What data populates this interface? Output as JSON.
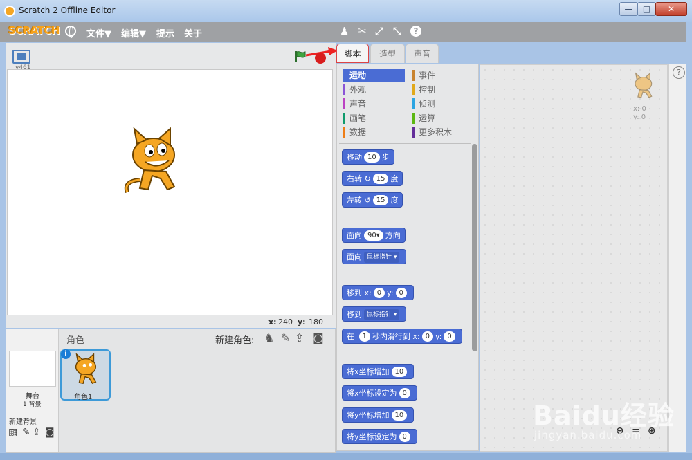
{
  "window": {
    "title": "Scratch 2 Offline Editor",
    "min": "—",
    "max": "□",
    "close": "✕"
  },
  "menubar": {
    "logo": "SCRATCH",
    "items": [
      "文件▼",
      "编辑▼",
      "提示",
      "关于"
    ]
  },
  "stage": {
    "version": "v461",
    "x_label": "x:",
    "x_value": "240",
    "y_label": "y:",
    "y_value": "180"
  },
  "tabs": [
    "脚本",
    "造型",
    "声音"
  ],
  "categories": [
    {
      "label": "运动",
      "color": "#4a6cd4"
    },
    {
      "label": "事件",
      "color": "#c88330"
    },
    {
      "label": "外观",
      "color": "#8a55d7"
    },
    {
      "label": "控制",
      "color": "#e1a91a"
    },
    {
      "label": "声音",
      "color": "#bb42c3"
    },
    {
      "label": "侦测",
      "color": "#2ca5e2"
    },
    {
      "label": "画笔",
      "color": "#0e9a6c"
    },
    {
      "label": "运算",
      "color": "#5cb712"
    },
    {
      "label": "数据",
      "color": "#ee7d16"
    },
    {
      "label": "更多积木",
      "color": "#632d99"
    }
  ],
  "blocks": {
    "move": {
      "a": "移动",
      "v": "10",
      "b": "步"
    },
    "turn_right": {
      "a": "右转",
      "icon": "↻",
      "v": "15",
      "b": "度"
    },
    "turn_left": {
      "a": "左转",
      "icon": "↺",
      "v": "15",
      "b": "度"
    },
    "point_dir": {
      "a": "面向",
      "v": "90▾",
      "b": "方向"
    },
    "point_towards": {
      "a": "面向",
      "dd": "鼠标指针 ▾"
    },
    "goto_xy": {
      "a": "移到",
      "x": "x:",
      "xv": "0",
      "y": "y:",
      "yv": "0"
    },
    "goto": {
      "a": "移到",
      "dd": "鼠标指针 ▾"
    },
    "glide": {
      "a": "在",
      "v": "1",
      "b": "秒内滑行到",
      "x": "x:",
      "xv": "0",
      "y": "y:",
      "yv": "0"
    },
    "change_x": {
      "a": "将x坐标增加",
      "v": "10"
    },
    "set_x": {
      "a": "将x坐标设定为",
      "v": "0"
    },
    "change_y": {
      "a": "将y坐标增加",
      "v": "10"
    },
    "set_y": {
      "a": "将y坐标设定为",
      "v": "0"
    }
  },
  "sprites": {
    "title": "角色",
    "new_sprite": "新建角色:",
    "stage_label": "舞台",
    "backdrop_count": "1 背景",
    "new_backdrop": "新建背景",
    "sprite1_name": "角色1",
    "info": "i"
  },
  "script_area": {
    "x": "x: 0",
    "y": "y: 0",
    "help": "?"
  },
  "watermark": {
    "logo": "Baidu经验",
    "url": "jingyan.baidu.com"
  }
}
